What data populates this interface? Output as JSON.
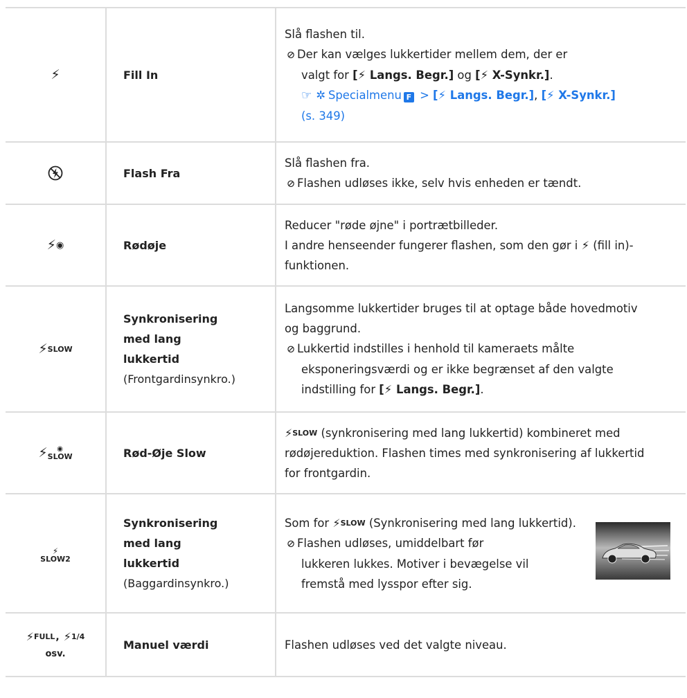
{
  "rows": [
    {
      "icon": "flash-fill-in-icon",
      "name": "Fill In",
      "desc": {
        "line1": "Slå flashen til.",
        "line2": "Der kan vælges lukkertider mellem dem, der er",
        "line3_pre": "valgt for ",
        "b1_open": "[",
        "b1_text": " Langs. Begr.]",
        "line3_mid": " og ",
        "b2_open": "[",
        "b2_text": " X-Synkr.]",
        "line3_end": ".",
        "menu_link": "Specialmenu",
        "menu_box": "F",
        "gt": " > ",
        "link1_open": "[",
        "link1_text": " Langs. Begr.]",
        "comma": ", ",
        "link2_open": "[",
        "link2_text": " X-Synkr.]",
        "page_ref": "(s. 349)"
      }
    },
    {
      "icon": "flash-off-icon",
      "name": "Flash Fra",
      "desc": {
        "line1": "Slå flashen fra.",
        "line2": "Flashen udløses ikke, selv hvis enheden er tændt."
      }
    },
    {
      "icon": "flash-red-eye-icon",
      "name": "Rødøje",
      "desc": {
        "line1": "Reducer \"røde øjne\" i portrætbilleder.",
        "line2_pre": "I andre henseender fungerer flashen, som den gør i ",
        "line2_post": " (fill in)-",
        "line3": "funktionen."
      }
    },
    {
      "icon": "flash-slow-icon",
      "icon_sub": "SLOW",
      "name": "Synkronisering med lang lukkertid",
      "name_sub": "(Frontgardinsynkro.)",
      "desc": {
        "line1": "Langsomme lukkertider bruges til at optage både hovedmotiv",
        "line2": "og baggrund.",
        "line3": "Lukkertid indstilles i henhold til kameraets målte",
        "line4": "eksponeringsværdi og er ikke begrænset af den valgte",
        "line5_pre": "indstilling for ",
        "b_open": "[",
        "b_text": " Langs. Begr.]",
        "line5_end": "."
      }
    },
    {
      "icon": "flash-red-eye-slow-icon",
      "icon_sub": "SLOW",
      "name": "Rød-Øje Slow",
      "desc": {
        "inline_sub": "SLOW",
        "line1_post": " (synkronisering med lang lukkertid) kombineret med",
        "line2": "rødøjereduktion. Flashen times med synkronisering af lukkertid",
        "line3": "for frontgardin."
      }
    },
    {
      "icon": "flash-slow2-icon",
      "icon_sub": "SLOW2",
      "name": "Synkronisering med lang lukkertid",
      "name_sub": "(Baggardinsynkro.)",
      "desc": {
        "line1_pre": "Som for ",
        "inline_sub": "SLOW",
        "line1_post": " (Synkronisering med lang lukkertid).",
        "line2": "Flashen udløses, umiddelbart før",
        "line3": "lukkeren lukkes. Motiver i bevægelse vil",
        "line4": "fremstå med lysspor efter sig."
      }
    },
    {
      "icon": "flash-manual-icon",
      "icon_full": "FULL",
      "icon_sep": ",",
      "icon_quarter": "1/4",
      "icon_etc": "osv.",
      "name": "Manuel værdi",
      "desc": {
        "line1": "Flashen udløses ved det valgte niveau."
      }
    }
  ],
  "colors": {
    "link": "#1f78e8",
    "border": "#dcdcdc",
    "text": "#222222"
  }
}
